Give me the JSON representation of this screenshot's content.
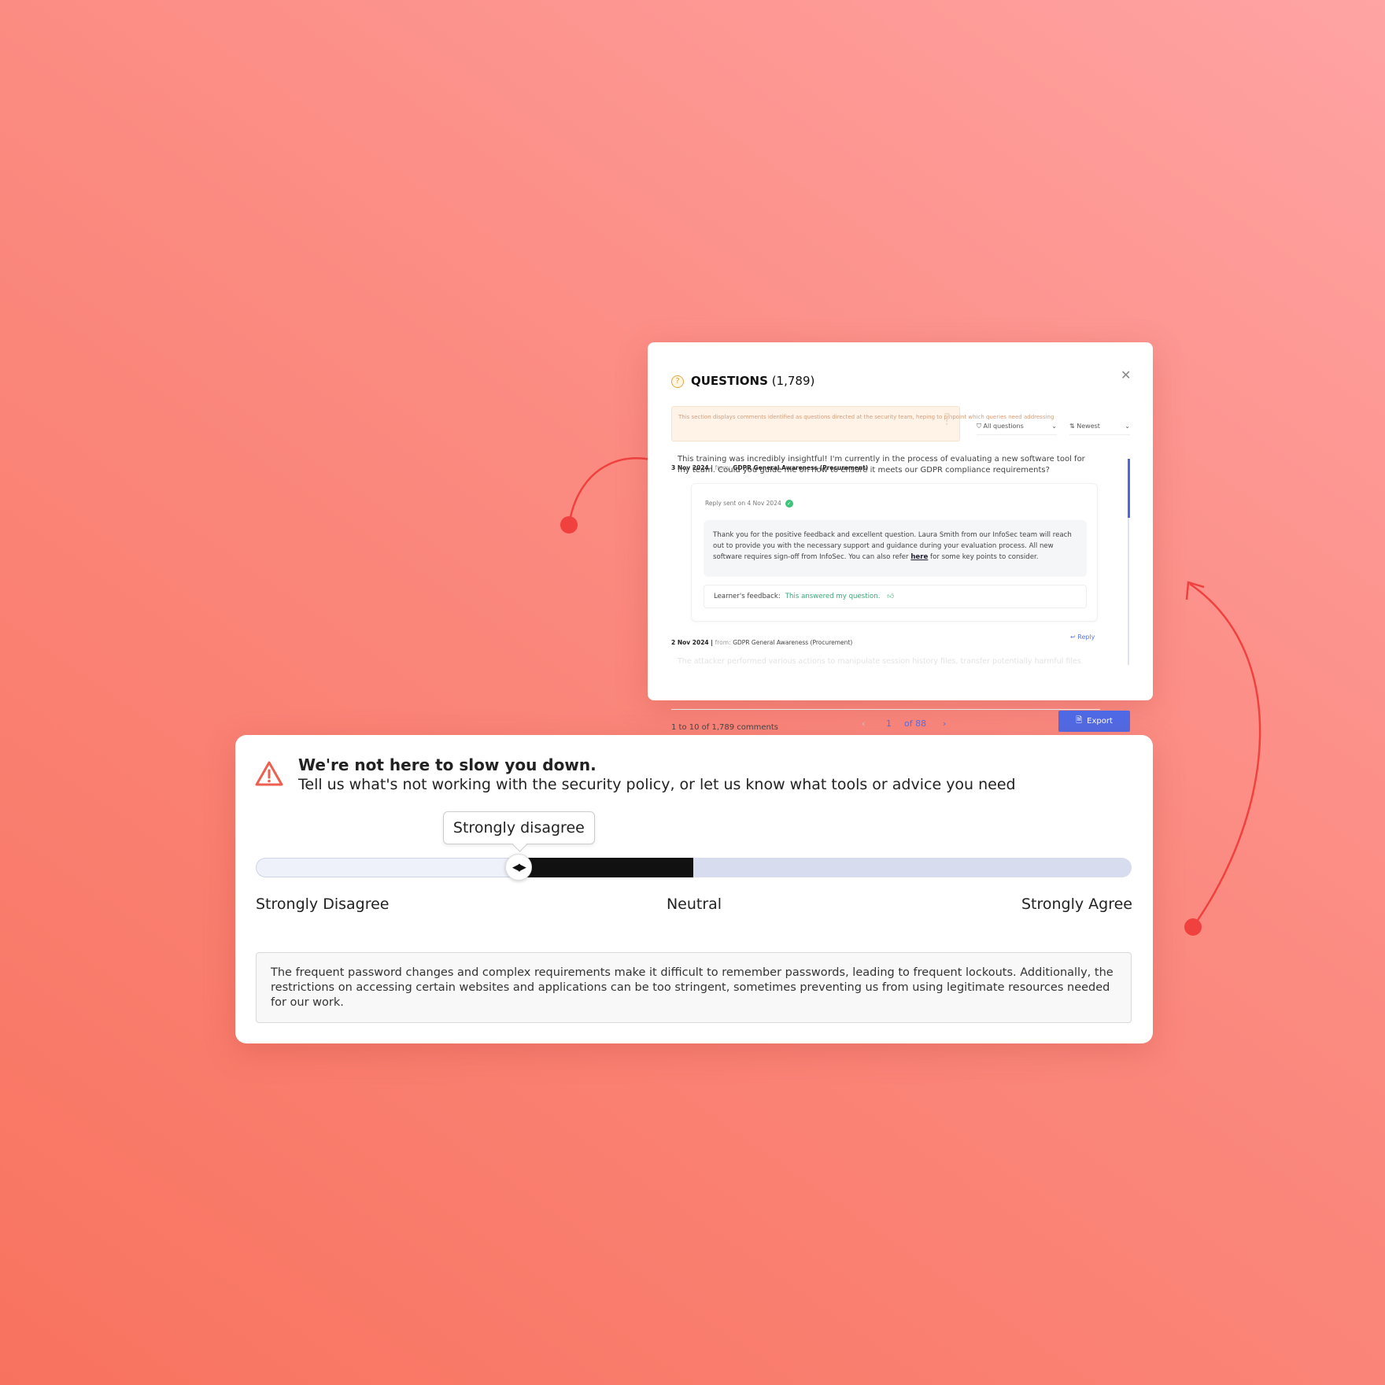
{
  "questions_panel": {
    "title": "QUESTIONS",
    "count": "(1,789)",
    "info": "This section displays comments identified as questions directed at the security team, heping to pinpoint which queries need addressing",
    "filter": "All questions",
    "sort": "Newest",
    "comments": [
      {
        "date": "3 Nov 2024 |",
        "from_label": "from:",
        "source": "GDPR General Awareness (Procurement)",
        "text": "This training was incredibly insightful! I'm currently in the process of evaluating a new software tool for my team. Could you guide me on how to ensure it meets our GDPR compliance requirements?",
        "reply_sent": "Reply sent on 4 Nov 2024",
        "reply_before": "Thank you for the positive feedback and excellent question. Laura Smith from our InfoSec team will reach out to provide you with the necessary support and guidance during your evaluation process. All new software requires sign-off from InfoSec. You can also refer ",
        "reply_link": "here",
        "reply_after": " for some key points to consider.",
        "feedback_label": "Learner's feedback:",
        "feedback": "This answered my question."
      },
      {
        "date": "2 Nov 2024 |",
        "from_label": "from:",
        "source": "GDPR General Awareness (Procurement)",
        "reply_label": "Reply",
        "text": "The attacker performed various actions to manipulate session history files, transfer potentially harmful files"
      }
    ],
    "footer": "1 to 10 of 1,789 comments",
    "page": "1",
    "of_pages": "of 88",
    "export": "Export"
  },
  "survey": {
    "title": "We're not here to slow you down.",
    "subtitle": "Tell us what's not working with the security policy, or let us know what tools or advice you need",
    "tooltip": "Strongly disagree",
    "slider_value": 0.3,
    "labels": [
      "Strongly Disagree",
      "Neutral",
      "Strongly Agree"
    ],
    "response": "The frequent password changes and complex requirements make it difficult to remember passwords, leading to frequent lockouts. Additionally, the restrictions on accessing certain websites and applications can be too stringent, sometimes preventing us from using legitimate resources needed for our work."
  },
  "colors": {
    "accent": "#4f6ae6",
    "warning": "#ee5f4f",
    "arrow": "#f0413f"
  }
}
